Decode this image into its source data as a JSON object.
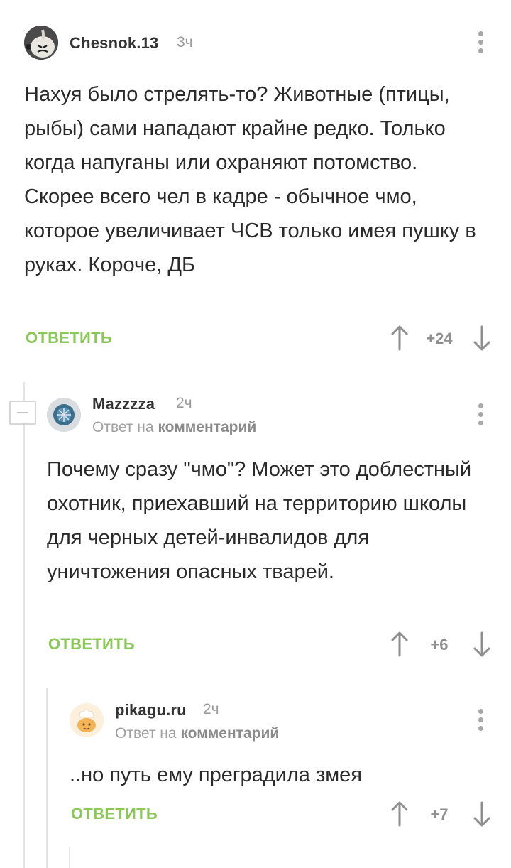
{
  "comments": [
    {
      "author": "Chesnok.13",
      "time": "3ч",
      "text": "Нахуя было стрелять-то? Животные (птицы, рыбы) сами нападают крайне редко. Только когда напуганы или охраняют потомство. Скорее всего чел в кадре - обычное чмо, которое увеличивает ЧСВ только имея пушку в руках. Короче, ДБ",
      "reply_label": "ОТВЕТИТЬ",
      "score": "+24"
    },
    {
      "author": "Mazzzza",
      "time": "2ч",
      "reply_prefix": "Ответ на",
      "reply_target": "комментарий",
      "text": "Почему сразу \"чмо\"? Может это доблестный охотник, приехавший на территорию школы для черных детей-инвалидов для уничтожения опасных тварей.",
      "reply_label": "ОТВЕТИТЬ",
      "score": "+6"
    },
    {
      "author": "pikagu.ru",
      "time": "2ч",
      "reply_prefix": "Ответ на",
      "reply_target": "комментарий",
      "text": "..но путь ему преградила змея",
      "reply_label": "ОТВЕТИТЬ",
      "score": "+7"
    }
  ],
  "icons": {
    "more": "more-vertical-icon",
    "upvote": "arrow-up-icon",
    "downvote": "arrow-down-icon",
    "collapse": "minus-icon"
  },
  "colors": {
    "accent_green": "#8ac858",
    "muted_text": "#9a9a9a",
    "thread_line": "#e4e4e4"
  }
}
